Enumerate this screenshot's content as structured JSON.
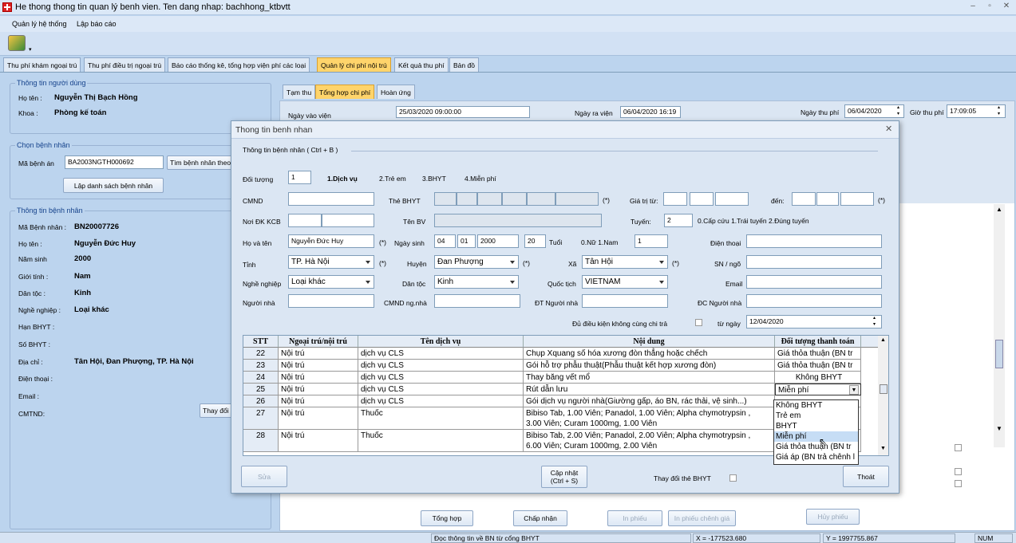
{
  "app": {
    "title": "He thong thong tin quan lý benh vien. Ten dang nhap: bachhong_ktbvtt"
  },
  "menu": [
    "Quản lý hệ thống",
    "Lập báo cáo"
  ],
  "main_tabs": [
    "Thu phí khám ngoại trú",
    "Thu phí điều trị ngoại trú",
    "Báo cáo thống kê, tổng hợp viện phí các loại",
    "Quản lý chi phí nội trú",
    "Kết quả thu phí",
    "Bản đồ"
  ],
  "user_group": {
    "title": "Thông tin người dùng",
    "name_label": "Họ tên :",
    "name": "Nguyễn Thị Bạch Hồng",
    "dept_label": "Khoa :",
    "dept": "Phòng kế toán"
  },
  "choose_group": {
    "title": "Chọn bệnh nhân",
    "record_label": "Mã bệnh án",
    "record_value": "BA2003NGTH000692",
    "search_btn": "Tìm bệnh nhân theo",
    "list_btn": "Lập danh sách bệnh nhân"
  },
  "patient_group": {
    "title": "Thông tin bệnh nhân",
    "id_label": "Mã Bệnh nhân :",
    "id": "BN20007726",
    "name_label": "Họ tên :",
    "name": "Nguyễn Đức Huy",
    "birth_label": "Năm sinh",
    "birth": "2000",
    "sex_label": "Giới tính :",
    "sex": "Nam",
    "ethnic_label": "Dân tộc :",
    "ethnic": "Kinh",
    "job_label": "Nghề nghiệp :",
    "job": "Loại khác",
    "bhyt_exp_label": "Hạn BHYT :",
    "bhyt_no_label": "Số BHYT :",
    "addr_label": "Địa chỉ :",
    "addr": "Tân Hội, Đan Phượng, TP. Hà Nội",
    "phone_label": "Điện thoại :",
    "email_label": "Email :",
    "cmtnd_label": "CMTND:",
    "change_btn": "Thay đổi"
  },
  "sub_tabs": [
    "Tạm thu",
    "Tổng hợp chi phí",
    "Hoàn ứng"
  ],
  "dates": {
    "admit_label": "Ngày vào viện",
    "admit": "25/03/2020 09:00:00",
    "discharge_label": "Ngày ra viện",
    "discharge": "06/04/2020 16:19",
    "pay_date_label": "Ngày thu phí",
    "pay_date": "06/04/2020",
    "pay_time_label": "Giờ thu phí",
    "pay_time": "17:09:05"
  },
  "bottom_buttons": [
    "Tổng hợp",
    "Chấp nhận",
    "In phiếu",
    "In phiếu chênh giá",
    "Hủy phiếu"
  ],
  "status": {
    "msg": "Đọc thông tin về BN từ cổng BHYT",
    "x": "X = -177523.680",
    "y": "Y = 1997755.867",
    "num": "NUM"
  },
  "modal": {
    "title": "Thong tin benh nhan",
    "section": "Thông tin bệnh nhân ( Ctrl + B )",
    "doi_tuong_label": "Đối tượng",
    "doi_tuong_value": "1",
    "doi_tuong_opts": [
      "1.Dịch vụ",
      "2.Trẻ em",
      "3.BHYT",
      "4.Miễn phí"
    ],
    "cmnd_label": "CMND",
    "the_bhyt_label": "Thẻ BHYT",
    "star": "(*)",
    "gia_tri_tu_label": "Giá trị từ:",
    "den_label": "đến:",
    "noi_dk_label": "Nơi ĐK KCB",
    "ten_bv_label": "Tên BV",
    "tuyen_label": "Tuyến:",
    "tuyen_value": "2",
    "tuyen_opts": "0.Cấp cứu  1.Trái tuyến  2.Đúng tuyến",
    "hoten_label": "Họ và tên",
    "hoten": "Nguyễn Đức Huy",
    "ngaysinh_label": "Ngày sinh",
    "day": "04",
    "month": "01",
    "year": "2000",
    "age": "20",
    "tuoi_label": "Tuổi",
    "sex_opts": "0.Nữ  1.Nam",
    "sex_value": "1",
    "phone_label": "Điện thoại",
    "tinh_label": "Tỉnh",
    "tinh": "TP. Hà Nội",
    "huyen_label": "Huyện",
    "huyen": "Đan Phượng",
    "xa_label": "Xã",
    "xa": "Tân Hội",
    "sn_label": "SN / ngõ",
    "job_label": "Nghề nghiệp",
    "job": "Loại khác",
    "dantoc_label": "Dân tộc",
    "dantoc": "Kinh",
    "quoctich_label": "Quốc tịch",
    "quoctich": "VIETNAM",
    "email_label": "Email",
    "nguoinha_label": "Người nhà",
    "cmnd_nn_label": "CMND ng.nhà",
    "dt_nn_label": "ĐT Người nhà",
    "dc_nn_label": "ĐC Người nhà",
    "du_dk_label": "Đủ điều kiện không cùng chi trả",
    "tu_ngay_label": "từ ngày",
    "tu_ngay": "12/04/2020",
    "sua_btn": "Sửa",
    "capnhat_btn1": "Cập nhật",
    "capnhat_btn2": "(Ctrl + S)",
    "thaydoi_label": "Thay đổi thẻ BHYT",
    "thoat_btn": "Thoát"
  },
  "grid": {
    "headers": [
      "STT",
      "Ngoại trú/nội trú",
      "Tên dịch vụ",
      "Nội dung",
      "Đối tượng thanh toán"
    ],
    "rows": [
      {
        "stt": "22",
        "type": "Nội trú",
        "service": "dịch vụ CLS",
        "content1": "Chụp Xquang số hóa xương đòn thẳng hoặc chếch",
        "content2": "",
        "target": "Giá thỏa thuận (BN tr"
      },
      {
        "stt": "23",
        "type": "Nội trú",
        "service": "dịch vụ CLS",
        "content1": "Gói hỗ trợ phẫu thuật(Phẫu thuật kết hợp xương đòn)",
        "content2": "",
        "target": "Giá thỏa thuận (BN tr"
      },
      {
        "stt": "24",
        "type": "Nội trú",
        "service": "dịch vụ CLS",
        "content1": "Thay băng vết mổ",
        "content2": "",
        "target": "Không BHYT"
      },
      {
        "stt": "25",
        "type": "Nội trú",
        "service": "dịch vụ CLS",
        "content1": "Rút dẫn lưu",
        "content2": "",
        "target": "Miễn phí"
      },
      {
        "stt": "26",
        "type": "Nội trú",
        "service": "dịch vụ CLS",
        "content1": "Gói dịch vụ người nhà(Giường gấp, áo BN, rác thải, vệ sinh...)",
        "content2": "",
        "target": ""
      },
      {
        "stt": "27",
        "type": "Nội trú",
        "service": "Thuốc",
        "content1": "Bibiso Tab, 1.00 Viên; Panadol, 1.00 Viên; Alpha chymotrypsin ,",
        "content2": "3.00 Viên; Curam 1000mg, 1.00 Viên",
        "target": ""
      },
      {
        "stt": "28",
        "type": "Nội trú",
        "service": "Thuốc",
        "content1": "Bibiso Tab, 2.00 Viên; Panadol, 2.00 Viên; Alpha chymotrypsin ,",
        "content2": "6.00 Viên; Curam 1000mg, 2.00 Viên",
        "target": ""
      }
    ],
    "dropdown": [
      "Không BHYT",
      "Trẻ em",
      "BHYT",
      "Miễn phí",
      "Giá thỏa thuận (BN tr",
      "Giá áp (BN trả chênh l"
    ]
  }
}
